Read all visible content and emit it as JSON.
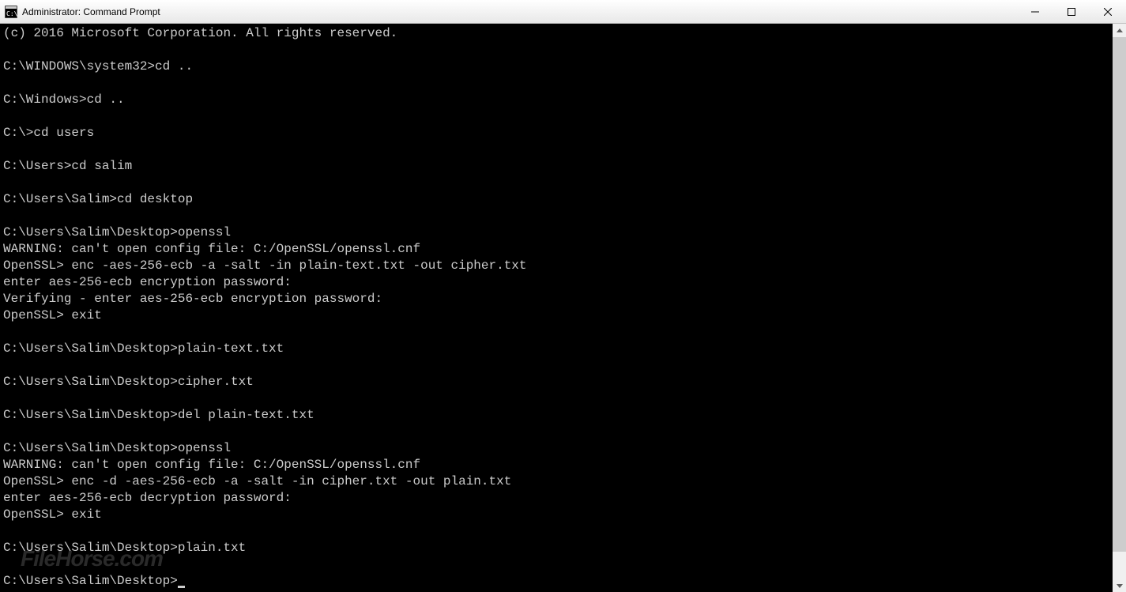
{
  "window": {
    "title": "Administrator: Command Prompt"
  },
  "terminal": {
    "lines": [
      "(c) 2016 Microsoft Corporation. All rights reserved.",
      "",
      "C:\\WINDOWS\\system32>cd ..",
      "",
      "C:\\Windows>cd ..",
      "",
      "C:\\>cd users",
      "",
      "C:\\Users>cd salim",
      "",
      "C:\\Users\\Salim>cd desktop",
      "",
      "C:\\Users\\Salim\\Desktop>openssl",
      "WARNING: can't open config file: C:/OpenSSL/openssl.cnf",
      "OpenSSL> enc -aes-256-ecb -a -salt -in plain-text.txt -out cipher.txt",
      "enter aes-256-ecb encryption password:",
      "Verifying - enter aes-256-ecb encryption password:",
      "OpenSSL> exit",
      "",
      "C:\\Users\\Salim\\Desktop>plain-text.txt",
      "",
      "C:\\Users\\Salim\\Desktop>cipher.txt",
      "",
      "C:\\Users\\Salim\\Desktop>del plain-text.txt",
      "",
      "C:\\Users\\Salim\\Desktop>openssl",
      "WARNING: can't open config file: C:/OpenSSL/openssl.cnf",
      "OpenSSL> enc -d -aes-256-ecb -a -salt -in cipher.txt -out plain.txt",
      "enter aes-256-ecb decryption password:",
      "OpenSSL> exit",
      "",
      "C:\\Users\\Salim\\Desktop>plain.txt",
      "",
      "C:\\Users\\Salim\\Desktop>"
    ]
  },
  "watermark": "FileHorse.com"
}
